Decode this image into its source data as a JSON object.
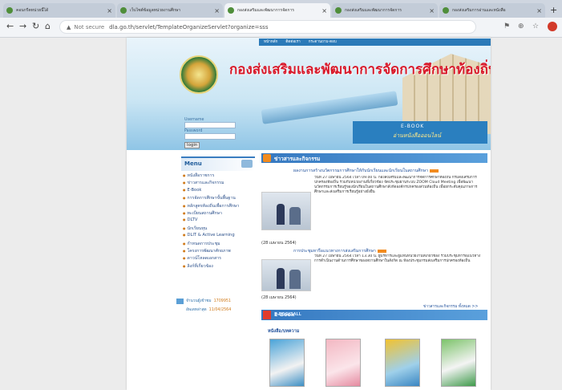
{
  "browser": {
    "tabs": [
      {
        "title": "คอนกรีตหน่วยนี้ได้"
      },
      {
        "title": "เว็บไซต์ข้อมูลหน่วยงานศึกษา"
      },
      {
        "title": "กองส่งเสริมและพัฒนาการจัดการ"
      },
      {
        "title": "กองส่งเสริมและพัฒนาการจัดการ"
      },
      {
        "title": "กองส่งเสริมการอ่านและหนังสือ"
      }
    ],
    "url_warning": "Not secure",
    "url": "dla.go.th/servlet/TemplateOrganizeServlet?organize=sss"
  },
  "site": {
    "topnav": [
      "หน้าหลัก",
      "ติดต่อเรา",
      "กระดานถาม-ตอบ"
    ],
    "title": "กองส่งเสริมและพัฒนาการจัดการศึกษาท้องถิ่น",
    "ebook_banner": {
      "line1": "E-BOOK",
      "line2": "อ่านหนังสือออนไลน์"
    },
    "login": {
      "username_label": "Username",
      "password_label": "Password",
      "button": "login"
    },
    "menu_title": "Menu",
    "menu_items": [
      "หนังสือราชการ",
      "ข่าวสารและกิจกรรม",
      "E-Book",
      "การจัดการศึกษาขั้นพื้นฐาน",
      "หลักสูตรท้องถิ่นเพื่อการศึกษา",
      "ทะเบียนสถานศึกษา",
      "DLTV",
      "นักเรียนทุน",
      "DLIT & Active Learning",
      "กำหนดการประชุม",
      "โครงการพัฒนาศักยภาพ",
      "ดาวน์โหลดเอกสาร",
      "ลิงก์ที่เกี่ยวข้อง"
    ],
    "stats": {
      "visitors_label": "จำนวนผู้เข้าชม",
      "visitors": "1709951",
      "updated_label": "อัพเดทล่าสุด",
      "updated": "11/04/2564"
    },
    "news_header": "ข่าวสารและกิจกรรม",
    "articles": [
      {
        "title": "ผลงานการสร้างนวัตกรรมการศึกษาให้กับนักเรียนและนักเรียนในสถานศึกษา",
        "body": "วันที่ 27 เมษายน 2564 เวลา 09.00 น. กองส่งเสริมและพัฒนาการจัดการศึกษาท้องถิ่น กรมส่งเสริมการปกครองท้องถิ่น ร่วมกับหน่วยงานที่เกี่ยวข้อง จัดประชุมผ่านระบบ ZOOM Cloud Meeting เพื่อพัฒนานวัตกรรมการเรียนรู้ของนักเรียนในสถานศึกษาสังกัดองค์กรปกครองส่วนท้องถิ่น เพื่อยกระดับคุณภาพการศึกษาและส่งเสริมการเรียนรู้อย่างยั่งยืน",
        "date": "(28 เมษายน 2564)"
      },
      {
        "title": "การประชุมหารือแนวทางการส่งเสริมการศึกษา",
        "body": "วันที่ 27 เมษายน 2564 เวลา 13.30 น. ผู้บริหารและผู้แทนหน่วยงานที่เกี่ยวข้อง ร่วมประชุมหารือแนวทางการดำเนินงานด้านการศึกษาของสถานศึกษาในสังกัด ณ ห้องประชุมกรมส่งเสริมการปกครองท้องถิ่น",
        "date": "(28 เมษายน 2564)"
      }
    ],
    "more_link": "ข่าวสารและกิจกรรม ทั้งหมด >>",
    "ebook_section": "E-Book",
    "ebook_right": "E-BOOK.ALL",
    "book_label": "หนังสือ/บทความ"
  }
}
